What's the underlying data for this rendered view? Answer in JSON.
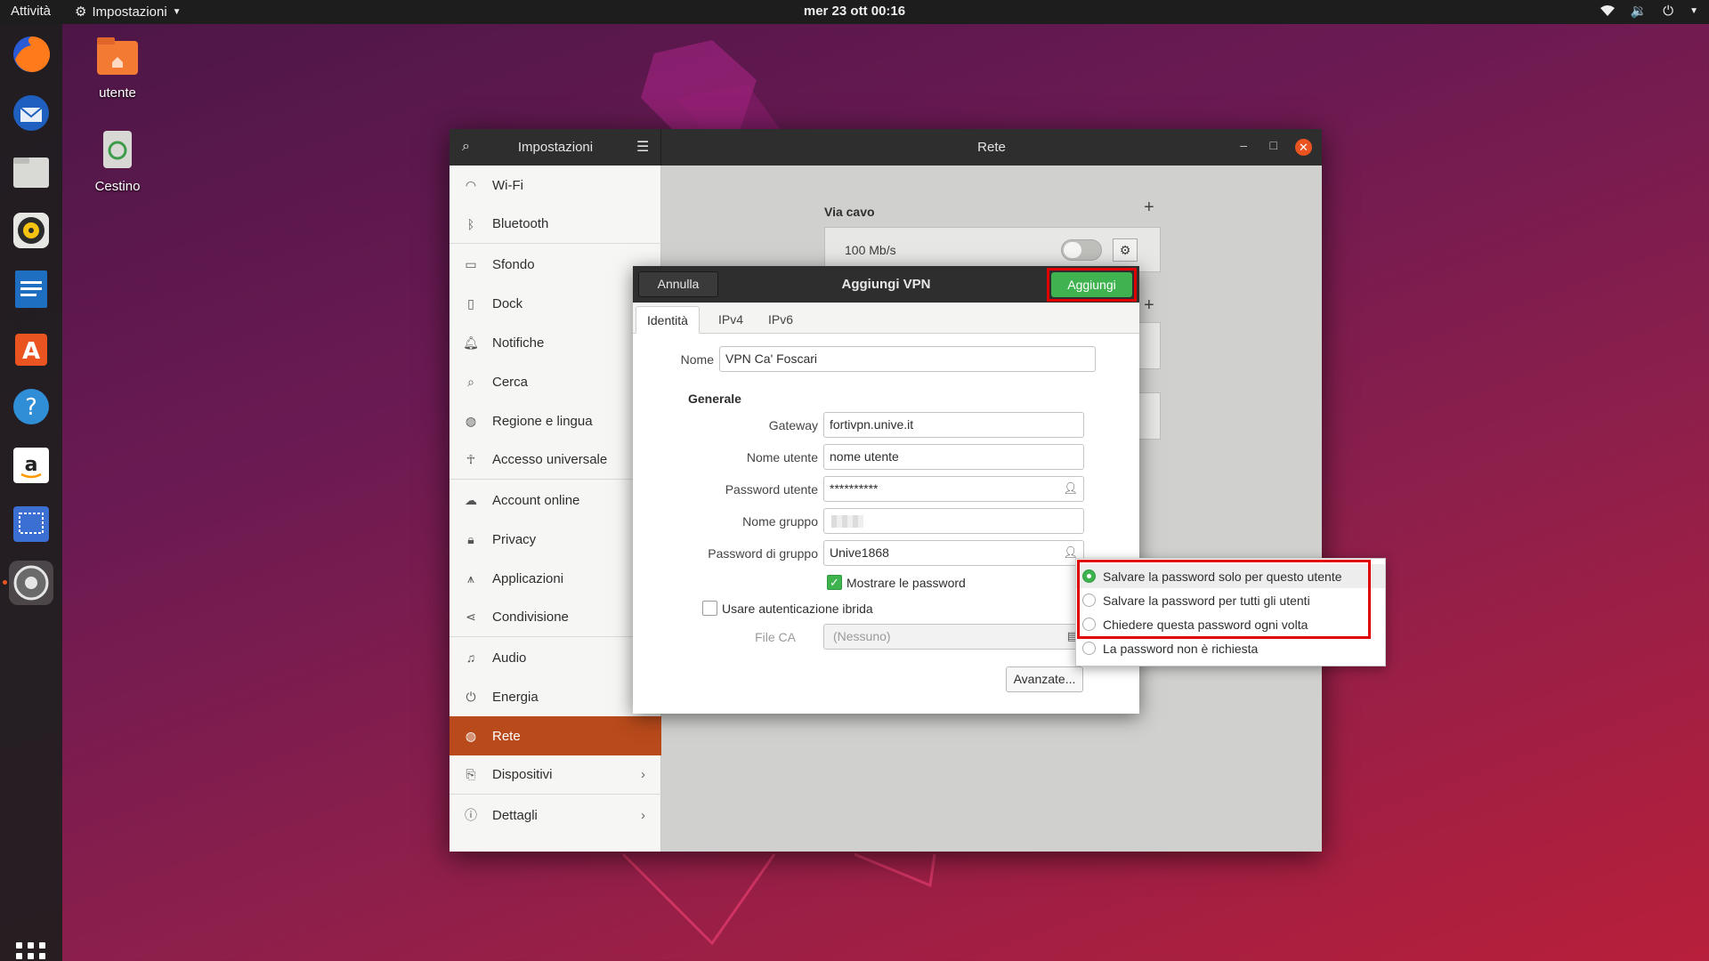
{
  "topbar": {
    "activities": "Attività",
    "app_name": "Impostazioni",
    "clock": "mer 23 ott  00:16"
  },
  "desktop": {
    "home_label": "utente",
    "trash_label": "Cestino"
  },
  "settings": {
    "sidebar_title": "Impostazioni",
    "main_title": "Rete",
    "sidebar_items": [
      {
        "label": "Wi-Fi",
        "icon": "wifi-icon"
      },
      {
        "label": "Bluetooth",
        "icon": "bluetooth-icon"
      },
      {
        "label": "Sfondo",
        "icon": "background-icon"
      },
      {
        "label": "Dock",
        "icon": "dock-icon"
      },
      {
        "label": "Notifiche",
        "icon": "bell-icon"
      },
      {
        "label": "Cerca",
        "icon": "search-icon"
      },
      {
        "label": "Regione e lingua",
        "icon": "globe-icon"
      },
      {
        "label": "Accesso universale",
        "icon": "accessibility-icon"
      },
      {
        "label": "Account online",
        "icon": "cloud-icon"
      },
      {
        "label": "Privacy",
        "icon": "lock-icon"
      },
      {
        "label": "Applicazioni",
        "icon": "apps-icon"
      },
      {
        "label": "Condivisione",
        "icon": "share-icon"
      },
      {
        "label": "Audio",
        "icon": "music-note-icon"
      },
      {
        "label": "Energia",
        "icon": "power-icon"
      },
      {
        "label": "Rete",
        "icon": "network-icon"
      },
      {
        "label": "Dispositivi",
        "icon": "devices-icon"
      },
      {
        "label": "Dettagli",
        "icon": "info-icon"
      }
    ],
    "wired_section": "Via cavo",
    "wired_speed": "100 Mb/s"
  },
  "dialog": {
    "title": "Aggiungi VPN",
    "cancel": "Annulla",
    "add": "Aggiungi",
    "tabs": [
      "Identità",
      "IPv4",
      "IPv6"
    ],
    "name_label": "Nome",
    "name_value": "VPN Ca' Foscari",
    "general_title": "Generale",
    "gateway_label": "Gateway",
    "gateway_value": "fortivpn.unive.it",
    "username_label": "Nome utente",
    "username_value": "nome utente",
    "userpass_label": "Password utente",
    "userpass_value": "**********",
    "group_label": "Nome gruppo",
    "grouppass_label": "Password di gruppo",
    "grouppass_value": "Unive1868",
    "show_pw_label": "Mostrare le password",
    "show_pw_checked": true,
    "hybrid_label": "Usare autenticazione ibrida",
    "hybrid_checked": false,
    "ca_label": "File CA",
    "ca_value": "(Nessuno)",
    "advanced": "Avanzate..."
  },
  "popover": {
    "options": [
      {
        "label": "Salvare la password solo per questo utente",
        "selected": true
      },
      {
        "label": "Salvare la password per tutti gli utenti",
        "selected": false
      },
      {
        "label": "Chiedere questa password ogni volta",
        "selected": false
      },
      {
        "label": "La password non è richiesta",
        "selected": false
      }
    ]
  },
  "colors": {
    "accent": "#e95420",
    "active_sidebar": "#b84a1b",
    "primary_button": "#3eb34f",
    "highlight_box": "#e00000"
  }
}
